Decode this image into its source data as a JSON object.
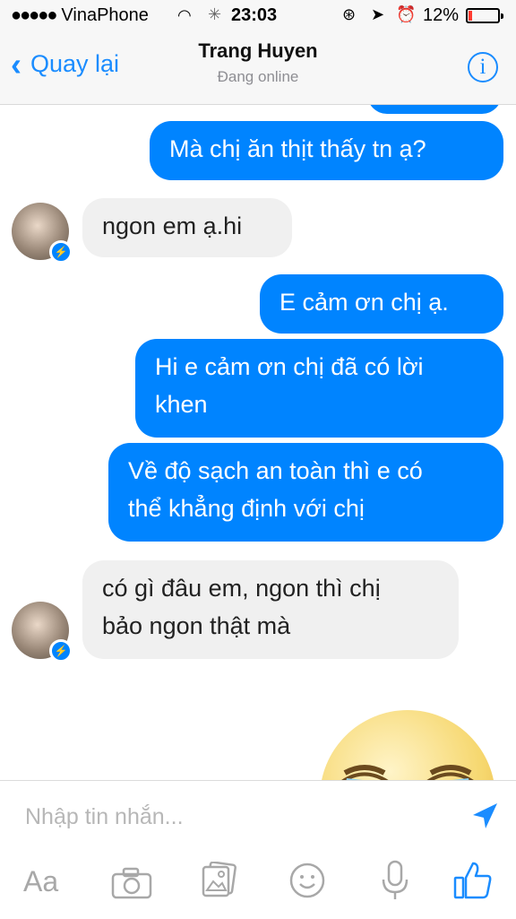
{
  "status_bar": {
    "carrier": "VinaPhone",
    "time": "23:03",
    "battery": "12%",
    "battery_level": 0.12
  },
  "header": {
    "back_label": "Quay lại",
    "title": "Trang Huyen",
    "subtitle": "Đang online",
    "info_glyph": "i"
  },
  "messages": [
    {
      "side": "out",
      "text": "Mà chị ăn thịt thấy tn ạ?"
    },
    {
      "side": "in",
      "text": "ngon em ạ.hi"
    },
    {
      "side": "out",
      "text": "E cảm ơn chị ạ."
    },
    {
      "side": "out",
      "line1": "Hi e cảm ơn chị đã có lời",
      "line2": "khen"
    },
    {
      "side": "out",
      "line1": "Về độ sạch an toàn thì e có",
      "line2": "thể khẳng định với chị"
    },
    {
      "side": "in",
      "line1": "có gì đâu em, ngon thì chị",
      "line2": "bảo ngon thật mà"
    }
  ],
  "composer": {
    "placeholder": "Nhập tin nhắn...",
    "aa_label": "Aa"
  },
  "icons": [
    "chevron-left-icon",
    "info-icon",
    "messenger-badge-icon",
    "crying-emoji-sticker",
    "send-icon",
    "camera-icon",
    "gallery-icon",
    "smiley-icon",
    "microphone-icon",
    "thumbs-up-icon",
    "wifi-icon",
    "location-icon",
    "alarm-icon",
    "rotation-lock-icon"
  ],
  "colors": {
    "accent": "#0084ff",
    "ios_blue": "#1a8cff",
    "incoming_bubble": "#f0f0f0"
  }
}
